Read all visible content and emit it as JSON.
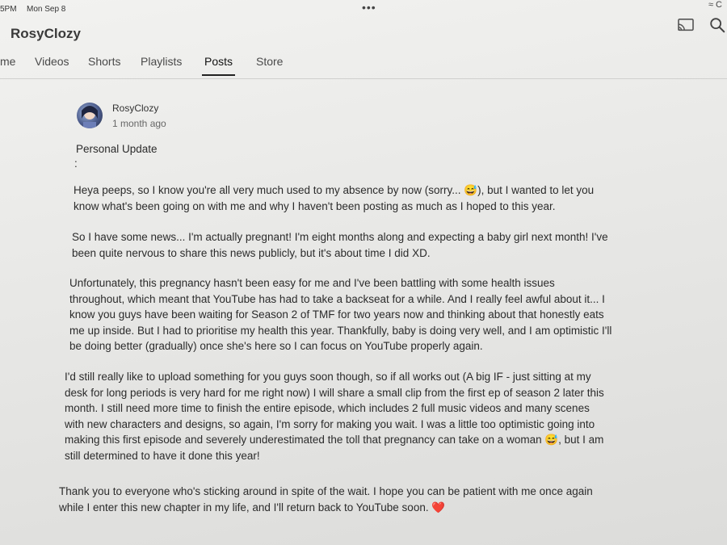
{
  "status_bar": {
    "time": "5PM",
    "date": "Mon Sep 8",
    "more": "•••",
    "wifi": "≈ C"
  },
  "header": {
    "channel_name": "RosyClozy"
  },
  "tabs": [
    {
      "label": "me"
    },
    {
      "label": "Videos"
    },
    {
      "label": "Shorts"
    },
    {
      "label": "Playlists"
    },
    {
      "label": "Posts",
      "active": true
    },
    {
      "label": "Store"
    }
  ],
  "post": {
    "author": "RosyClozy",
    "timestamp": "1 month ago",
    "title": "Personal Update",
    "paragraphs": [
      ":",
      "Heya peeps, so I know you're all very much used to my absence by now (sorry... 😅), but I wanted to let you\nknow what's been going on with me and why I haven't been posting as much as I hoped to this year.",
      "So I have some news... I'm actually pregnant! I'm eight months along and expecting a baby girl next month! I've\nbeen quite nervous to share this news publicly, but it's about time I did XD.",
      "Unfortunately, this pregnancy hasn't been easy for me and I've been battling with some health issues\nthroughout, which meant that YouTube has had to take a backseat for a while. And I really feel awful about it... I\nknow you guys have been waiting for Season 2 of TMF for two years now and thinking about that honestly eats\nme up inside. But I had to prioritise my health this year. Thankfully, baby is doing very well, and I am optimistic I'll\nbe doing better (gradually) once she's here so I can focus on YouTube properly again.",
      "I'd still really like to upload something for you guys soon though, so if all works out (A big IF - just sitting at my\ndesk for long periods is very hard for me right now) I will share a small clip from the first ep of season 2 later this\nmonth. I still need more time to finish the entire episode, which includes 2 full music videos and many scenes\nwith new characters and designs, so again, I'm sorry for making you wait. I was a little too optimistic going into\nmaking this first episode and severely underestimated the toll that pregnancy can take on a woman 😅, but I am\nstill determined to have it done this year!",
      "Thank you to everyone who's sticking around in spite of the wait. I hope you can be patient with me once again\nwhile I enter this new chapter in my life, and I'll return back to YouTube soon. ❤️"
    ]
  }
}
